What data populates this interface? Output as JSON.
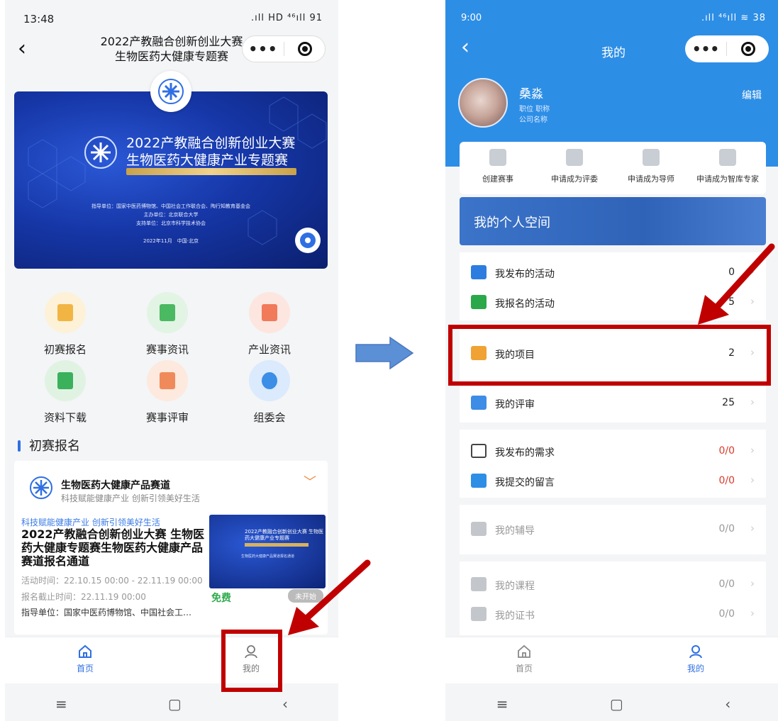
{
  "left": {
    "status_bar": {
      "time": "13:48",
      "icons": ".ıll HD ⁴⁶ıll 91"
    },
    "nav": {
      "title_line1": "2022产教融合创新创业大赛",
      "title_line2": "生物医药大健康专题赛",
      "back": "‹",
      "more": "•••"
    },
    "banner": {
      "title1": "2022产教融合创新创业大赛",
      "title2": "生物医药大健康产业专题赛",
      "strip": "科技赋能健康产业 创新引领美好生活",
      "guide": "指导单位：国家中医药博物馆、中国社会工作联合会、陶行知教育基金会",
      "host": "主办单位：北京联合大学",
      "support": "支持单位：北京市科学技术协会",
      "date": "2022年11月　中国·北京"
    },
    "menu": [
      {
        "label": "初赛报名",
        "color": "#f2b544",
        "bg": "#fdf1d8"
      },
      {
        "label": "赛事资讯",
        "color": "#4bb862",
        "bg": "#e2f4e4"
      },
      {
        "label": "产业资讯",
        "color": "#f07a5a",
        "bg": "#fde6df"
      },
      {
        "label": "资料下载",
        "color": "#3bb15c",
        "bg": "#e0f3e3"
      },
      {
        "label": "赛事评审",
        "color": "#f08a5a",
        "bg": "#fde9de"
      },
      {
        "label": "组委会",
        "color": "#3c8ee6",
        "bg": "#dbeafc"
      }
    ],
    "section_title": "初赛报名",
    "card": {
      "heading": "生物医药大健康产品赛道",
      "subheading": "科技赋能健康产业 创新引领美好生活",
      "tag": "科技赋能健康产业 创新引领美好生活",
      "title": "2022产教融合创新创业大赛 生物医药大健康专题赛生物医药大健康产品赛道报名通道",
      "activity_time": "活动时间：22.10.15 00:00 - 22.11.19 00:00",
      "deadline": "报名截止时间：22.11.19 00:00",
      "guide": "指导单位：国家中医药博物馆、中国社会工…",
      "price": "免费",
      "status": "未开始",
      "thumb_title": "2022产教融合创新创业大赛 生物医药大健康产业专题赛",
      "thumb_text": "生物医药大健康产品赛道报名通道"
    },
    "tabbar": {
      "home": "首页",
      "mine": "我的"
    },
    "sysnav": {
      "menu": "≡",
      "home": "▢",
      "back": "‹"
    }
  },
  "right": {
    "status_bar": {
      "time": "9:00",
      "icons": ".ıll ⁴⁶ıll ≋ 38"
    },
    "nav": {
      "title": "我的",
      "back": "‹",
      "more": "•••"
    },
    "user": {
      "name": "桑淼",
      "position": "职位 职称",
      "company": "公司名称",
      "edit": "编辑"
    },
    "actions": [
      "创建赛事",
      "申请成为评委",
      "申请成为导师",
      "申请成为智库专家"
    ],
    "space_title": "我的个人空间",
    "groups": [
      [
        {
          "label": "我发布的活动",
          "value": "0",
          "icon_color": "#2d7de0"
        },
        {
          "label": "我报名的活动",
          "value": "5",
          "icon_color": "#2aa84a"
        }
      ],
      [
        {
          "label": "我的项目",
          "value": "2",
          "icon_color": "#f0a234"
        },
        {
          "label": "我的评审",
          "value": "25",
          "icon_color": "#3d8ce6"
        }
      ],
      [
        {
          "label": "我发布的需求",
          "value": "0/0",
          "icon_color": "#444444"
        },
        {
          "label": "我提交的留言",
          "value": "0/0",
          "icon_color": "#2d8ee6"
        }
      ],
      [
        {
          "label": "我的辅导",
          "value": "0/0",
          "icon_color": "#c3c7cc"
        }
      ],
      [
        {
          "label": "我的课程",
          "value": "0/0",
          "icon_color": "#c3c7cc"
        },
        {
          "label": "我的证书",
          "value": "0/0",
          "icon_color": "#c3c7cc"
        }
      ]
    ],
    "tabbar": {
      "home": "首页",
      "mine": "我的"
    },
    "sysnav": {
      "menu": "≡",
      "home": "▢",
      "back": "‹"
    }
  },
  "colors": {
    "brand_blue": "#2d8ee6",
    "highlight_red": "#c00000",
    "flow_arrow": "#5b8fd6"
  }
}
